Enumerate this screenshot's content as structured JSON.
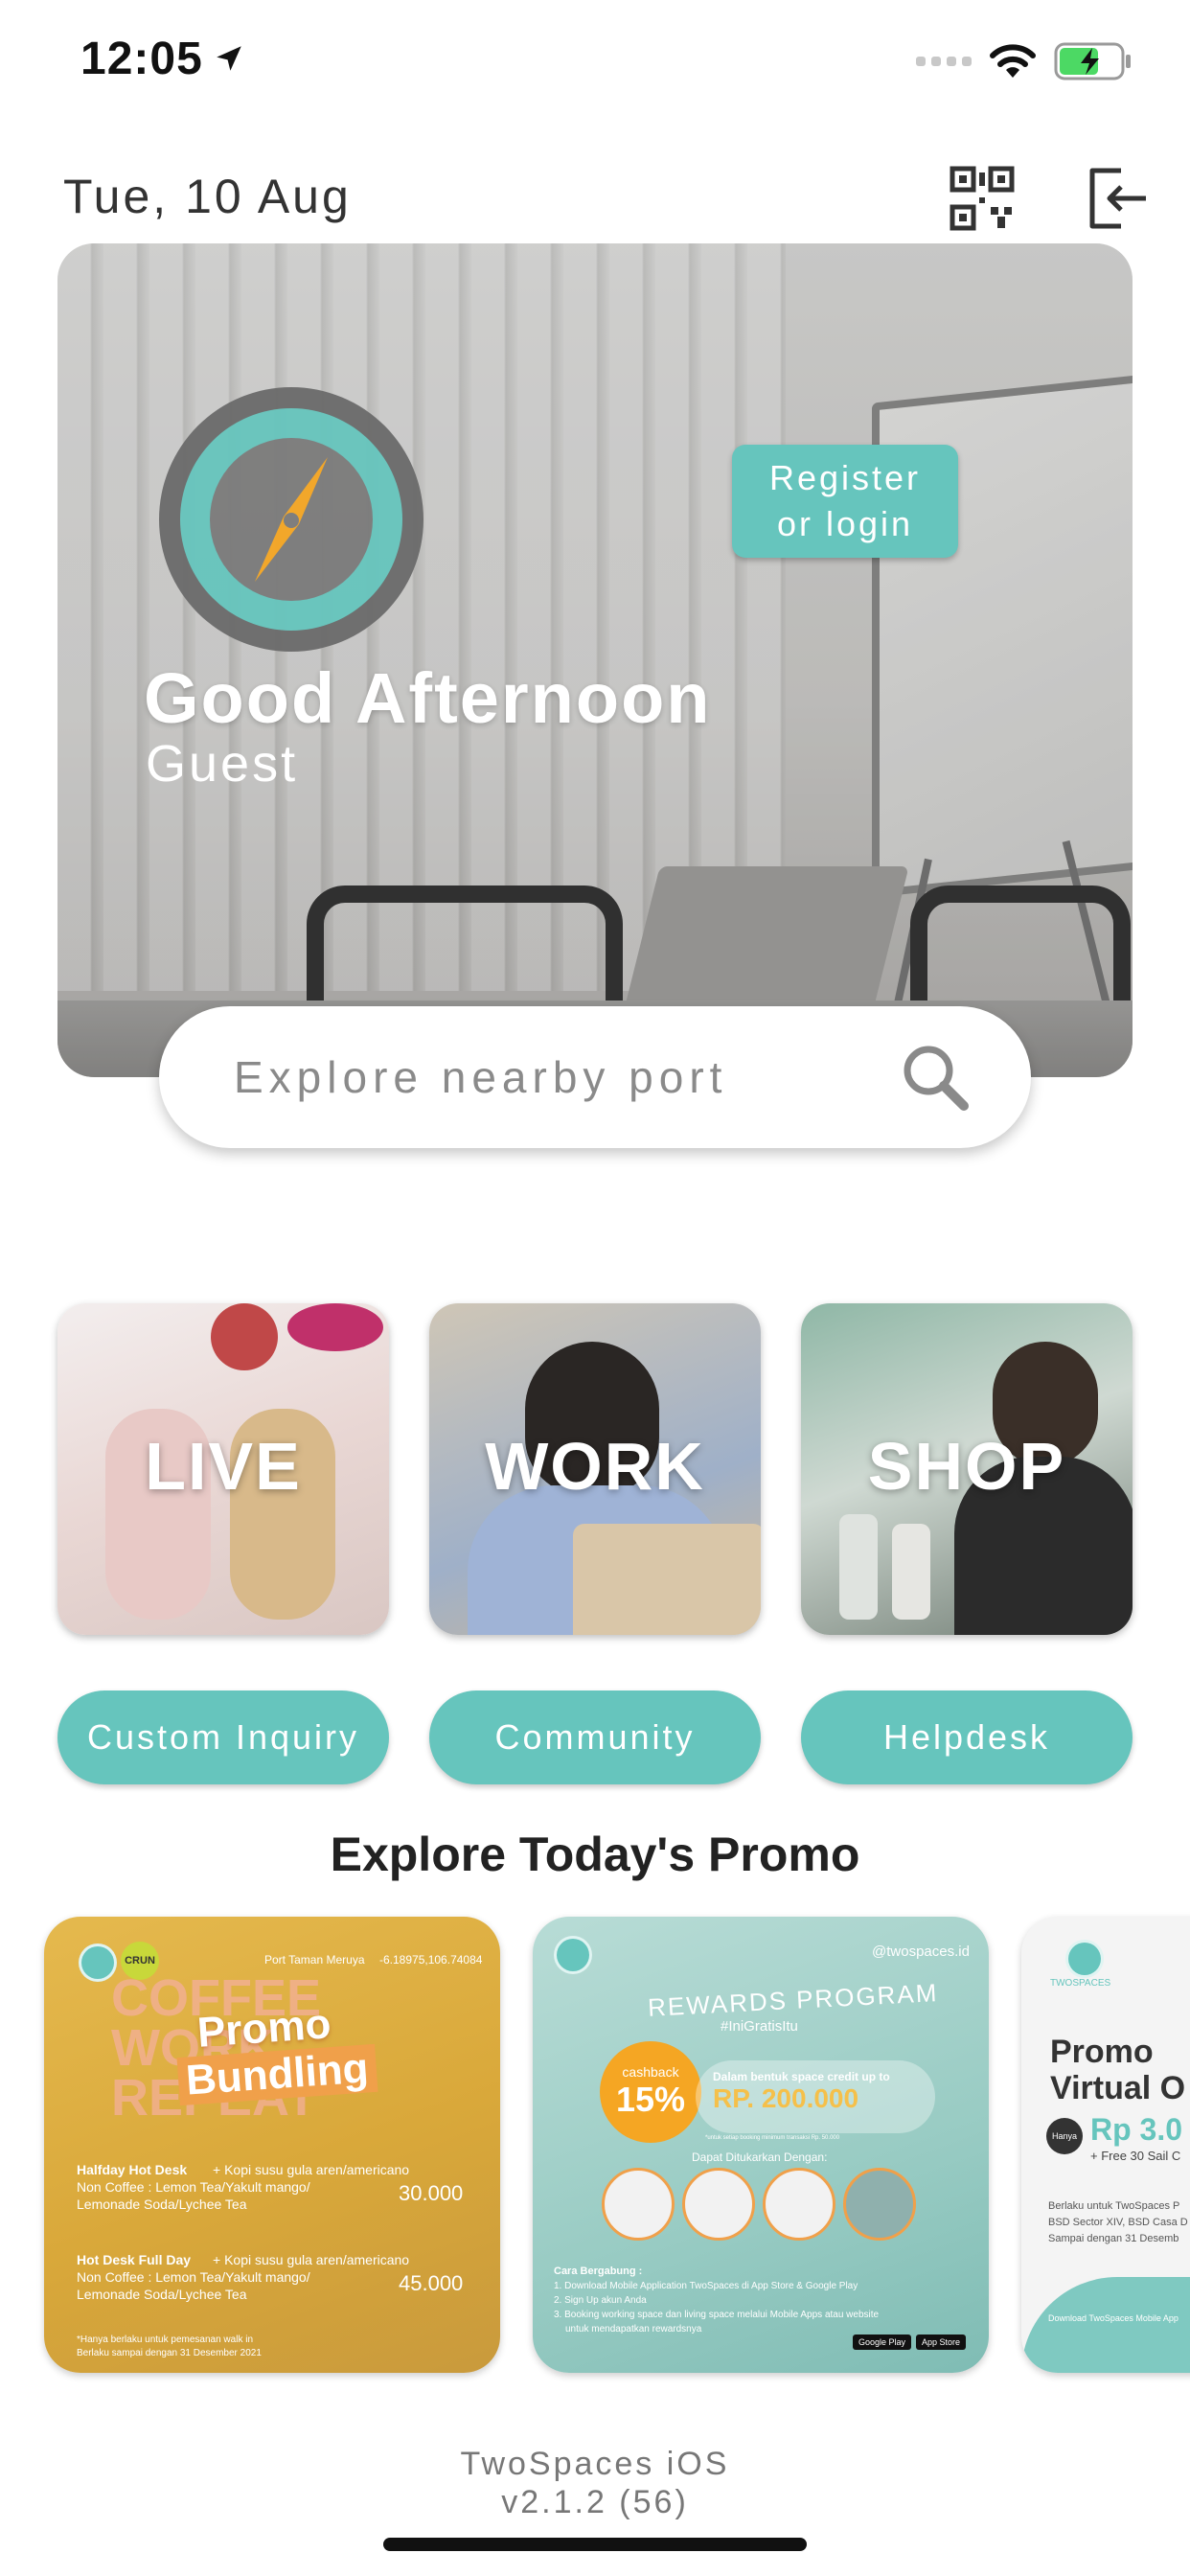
{
  "status_bar": {
    "time": "12:05",
    "icons": [
      "location-arrow-icon",
      "signal-icon",
      "wifi-icon",
      "battery-charging-icon"
    ]
  },
  "header": {
    "date": "Tue, 10 Aug",
    "qr_icon": "qr-code-icon",
    "logout_icon": "logout-icon"
  },
  "hero": {
    "register_line1": "Register",
    "register_line2": "or login",
    "greeting": "Good Afternoon",
    "user": "Guest"
  },
  "search": {
    "placeholder": "Explore nearby port",
    "icon": "search-icon"
  },
  "categories": [
    {
      "label": "LIVE"
    },
    {
      "label": "WORK"
    },
    {
      "label": "SHOP"
    }
  ],
  "actions": [
    {
      "label": "Custom Inquiry"
    },
    {
      "label": "Community"
    },
    {
      "label": "Helpdesk"
    }
  ],
  "promo": {
    "title": "Explore Today's Promo",
    "cards": [
      {
        "location": "Port Taman Meruya",
        "coords": "-6.18975,106.74084",
        "badge": "CRUN",
        "headline1": "Promo",
        "headline2": "Bundling",
        "bg_word1": "COFFEE",
        "bg_word2": "WORK",
        "bg_word3": "REPEAT",
        "item1_title": "Halfday Hot Desk",
        "item1_desc": "+ Kopi susu gula aren/americano",
        "item1_desc2": "Non Coffee : Lemon Tea/Yakult mango/",
        "item1_desc3": "Lemonade Soda/Lychee Tea",
        "item1_price": "30.000",
        "item2_title": "Hot Desk Full Day",
        "item2_desc": "+ Kopi susu gula aren/americano",
        "item2_desc2": "Non Coffee : Lemon Tea/Yakult mango/",
        "item2_desc3": "Lemonade Soda/Lychee Tea",
        "item2_price": "45.000",
        "note1": "*Hanya berlaku untuk pemesanan walk in",
        "note2": "Berlaku sampai dengan 31 Desember 2021"
      },
      {
        "handle": "@twospaces.id",
        "heading": "REWARDS PROGRAM",
        "hashtag": "#IniGratisItu",
        "cashback_label": "cashback",
        "cashback_value": "15%",
        "credit_label": "Dalam bentuk space credit up to",
        "credit_value": "RP. 200.000",
        "credit_note": "*untuk setiap booking minimum transaksi Rp. 50.000",
        "redeem_label": "Dapat Ditukarkan Dengan:",
        "steps_title": "Cara Bergabung :",
        "step1": "1. Download Mobile Application TwoSpaces di App Store & Google Play",
        "step2": "2. Sign Up akun Anda",
        "step3": "3. Booking working space dan living space melalui Mobile Apps atau website",
        "step3b": "untuk mendapatkan rewardsnya",
        "store1": "Google Play",
        "store2": "App Store"
      },
      {
        "brand": "TWOSPACES",
        "headline1": "Promo",
        "headline2": "Virtual O",
        "hanya": "Hanya",
        "price": "Rp 3.0",
        "bonus": "+ Free 30 Sail C",
        "line1": "Berlaku untuk TwoSpaces P",
        "line2": "BSD Sector XIV, BSD Casa D",
        "line3": "Sampai dengan 31 Desemb",
        "download": "Download TwoSpaces Mobile App"
      }
    ]
  },
  "footer": {
    "version_line1": "TwoSpaces iOS",
    "version_line2": "v2.1.2 (56)"
  },
  "colors": {
    "accent": "#66c5bd",
    "compass_needle": "#f5a623",
    "text_dark": "#222222"
  }
}
